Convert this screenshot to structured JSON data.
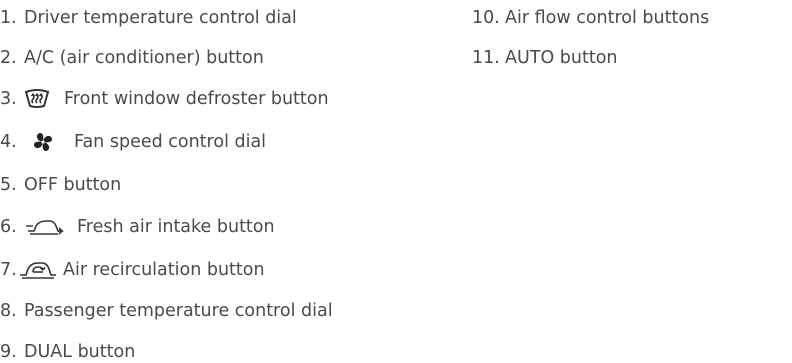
{
  "left_column": [
    {
      "number": "1.",
      "label": "Driver temperature control dial"
    },
    {
      "number": "2.",
      "label": "A/C (air conditioner) button"
    },
    {
      "number": "3.",
      "label": "Front window defroster button",
      "icon": "front-defroster-icon"
    },
    {
      "number": "4.",
      "label": "Fan speed control dial",
      "icon": "fan-icon"
    },
    {
      "number": "5.",
      "label": "OFF button"
    },
    {
      "number": "6.",
      "label": "Fresh air intake button",
      "icon": "fresh-air-icon"
    },
    {
      "number": "7.",
      "label": "Air recirculation button",
      "icon": "recirculation-icon"
    },
    {
      "number": "8.",
      "label": "Passenger temperature control dial"
    },
    {
      "number": "9.",
      "label": "DUAL button"
    }
  ],
  "right_column": [
    {
      "number": "10.",
      "label": "Air flow control buttons"
    },
    {
      "number": "11.",
      "label": "AUTO button"
    }
  ],
  "colors": {
    "text": "#4a4a4a",
    "icon": "#333333"
  }
}
